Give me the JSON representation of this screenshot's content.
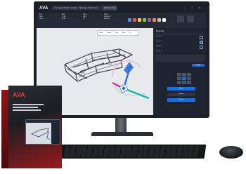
{
  "app": {
    "brand": "AVA",
    "tabs": [
      "Aimi Sample Product Leopard",
      "Cleaning Config for Ava",
      "Welcome Page"
    ],
    "window_controls": [
      "-",
      "□",
      "x"
    ]
  },
  "ribbon": {
    "groups": [
      {
        "label": "File",
        "items": [
          "New",
          "Open"
        ]
      },
      {
        "label": "Edit",
        "items": [
          "Undo",
          "Redo"
        ]
      },
      {
        "label": "View",
        "items": [
          "Zoom",
          "Fit"
        ]
      },
      {
        "label": "Tools",
        "items": [
          "Measure",
          "Section"
        ]
      }
    ],
    "palette": [
      "#4a90e2",
      "#e05555",
      "#f2c94c",
      "#8bc34a",
      "#9b59b6",
      "#ef8c3a",
      "#bfc5cf",
      "#ffffff"
    ]
  },
  "viewport": {
    "toolbar_items": [
      "Select",
      "Rotate",
      "Pan",
      "Zoom",
      "Fit"
    ],
    "axis_labels": [
      "X",
      "Y",
      "Z"
    ]
  },
  "panel": {
    "title": "Properties",
    "rows": [
      "Option 1",
      "Option 2",
      "Option 3",
      "Option 4"
    ],
    "primary_button": "Apply",
    "secondary_buttons": [
      "Export",
      "Import",
      "Reset"
    ]
  },
  "box": {
    "brand": "AVA",
    "headline": "Product Box"
  },
  "colors": {
    "accent_blue": "#1d6fe0",
    "axis_blue": "#2f6fe0",
    "axis_magenta": "#d23a9a",
    "axis_teal": "#19b6a4",
    "box_red": "#b3191d"
  }
}
